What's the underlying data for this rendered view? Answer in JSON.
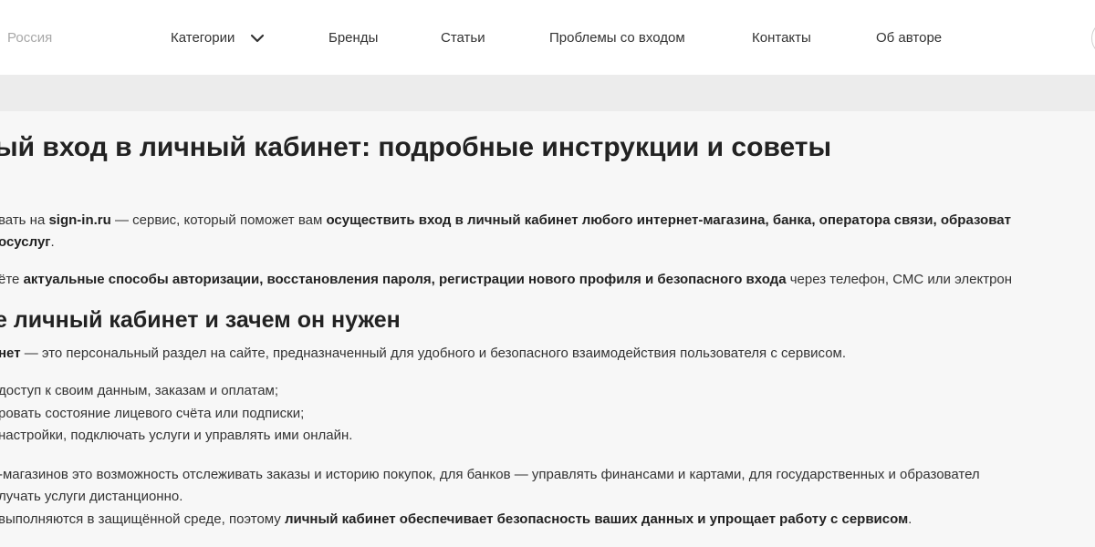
{
  "header": {
    "region": "Россия",
    "nav": {
      "categories": "Категории",
      "brands": "Бренды",
      "articles": "Статьи",
      "login_problems": "Проблемы со входом",
      "contacts": "Контакты",
      "about_author": "Об авторе"
    }
  },
  "article": {
    "title": "ый вход в личный кабинет: подробные инструкции и советы",
    "p1_a": "вать на ",
    "p1_b": "sign-in.ru",
    "p1_c": " — сервис, который поможет вам ",
    "p1_d": "осуществить вход в личный кабинет любого интернет-магазина, банка, оператора связи, образоват",
    "p1_e": "осуслуг",
    "p1_f": ".",
    "p2_a": "ёте ",
    "p2_b": "актуальные способы авторизации, восстановления пароля, регистрации нового профиля и безопасного входа",
    "p2_c": " через телефон, СМС или электрон",
    "h2": "е личный кабинет и зачем он нужен",
    "p3_a": "нет",
    "p3_b": " — это персональный раздел на сайте, предназначенный для удобного и безопасного взаимодействия пользователя с сервисом.",
    "list": [
      "доступ к своим данным, заказам и оплатам;",
      "ровать состояние лицевого счёта или подписки;",
      "настройки, подключать услуги и управлять ими онлайн."
    ],
    "p4_a": "-магазинов это возможность отслеживать заказы и историю покупок, для банков — управлять финансами и картами, для государственных и образовател",
    "p4_b": "лучать услуги дистанционно.",
    "p5_a": "выполняются в защищённой среде, поэтому ",
    "p5_b": "личный кабинет обеспечивает безопасность ваших данных и упрощает работу с сервисом",
    "p5_c": "."
  }
}
